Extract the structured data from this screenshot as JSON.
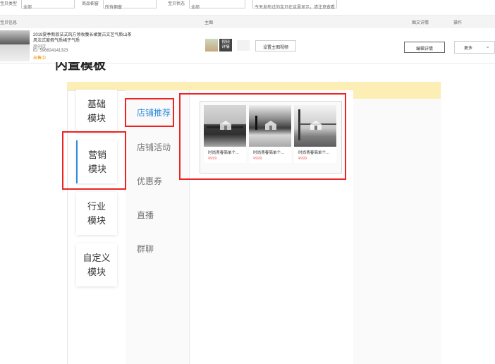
{
  "top_filters": {
    "filter1_label": "宝贝类型",
    "filter1_value": "全部",
    "filter2_label": "商品橱窗",
    "filter2_value": "所有橱窗",
    "filter3_label": "宝贝状态",
    "filter3_value": "全部",
    "right_link": "今天发布过的宝贝在这里显示，请注意查看"
  },
  "table_header": {
    "col1": "宝贝信息",
    "col2": "主图",
    "col3": "图文详情",
    "col4": "操作"
  },
  "product": {
    "title_line1": "2019夏季新款法式风方领收腰长裙复古文艺气质山茶",
    "title_line2": "风法式度假气质裙子气质",
    "shop": "原创店",
    "id_text": "ID: 596824141323",
    "status": "出售中",
    "thumb_badge_line1": "视频",
    "thumb_badge_line2": "详情",
    "set_button": "设置主图视频",
    "detail_button": "编辑详情",
    "more_button": "更多"
  },
  "partial_heading": "内置模板",
  "sidebar": {
    "items": [
      {
        "line1": "基础",
        "line2": "模块"
      },
      {
        "line1": "营销",
        "line2": "模块"
      },
      {
        "line1": "行业",
        "line2": "模块"
      },
      {
        "line1": "自定义",
        "line2": "模块"
      }
    ]
  },
  "tabs": [
    "店铺推荐",
    "店铺活动",
    "优惠券",
    "直播",
    "群聊"
  ],
  "cards": [
    {
      "caption": "时尚青春简单个...",
      "price": "¥999"
    },
    {
      "caption": "时尚青春简单个...",
      "price": "¥999"
    },
    {
      "caption": "时尚青春简单个...",
      "price": "¥999"
    }
  ],
  "colors": {
    "accent": "#2f8cdb",
    "highlight": "#e22222",
    "banner": "#fdeeb6",
    "price": "#ee6666"
  },
  "icons": {
    "more": "chevron-down-icon",
    "house": "house-icon"
  }
}
